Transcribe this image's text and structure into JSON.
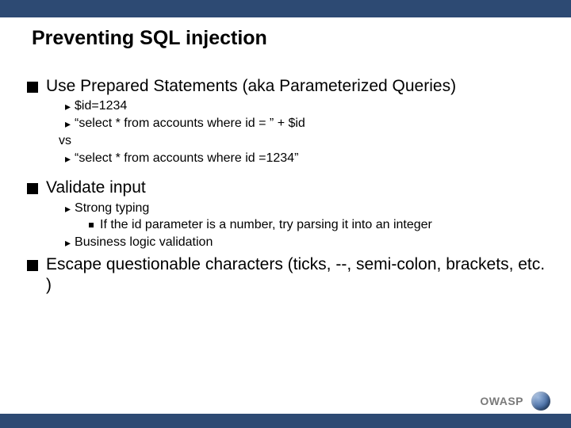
{
  "title": "Preventing SQL injection",
  "bullets": {
    "b1": "Use Prepared Statements (aka Parameterized Queries)",
    "b1_sub": {
      "a": "$id=1234",
      "b": "“select * from accounts where id = ” + $id",
      "vs": "vs",
      "c": "“select * from accounts where id =1234”"
    },
    "b2": "Validate input",
    "b2_sub": {
      "a": "Strong typing",
      "a1": "If the id parameter is a number, try parsing it into an integer",
      "b": "Business logic validation"
    },
    "b3": "Escape questionable characters (ticks, --, semi-colon, brackets, etc. )"
  },
  "footer": {
    "brand": "OWASP"
  }
}
